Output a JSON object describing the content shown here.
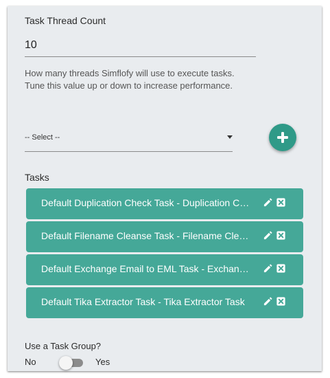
{
  "thread_count": {
    "label": "Task Thread Count",
    "value": "10",
    "help": "How many threads Simflofy will use to execute tasks. Tune this value up or down to increase performance."
  },
  "task_select": {
    "selected": "-- Select --",
    "add_icon": "plus-icon"
  },
  "tasks": {
    "label": "Tasks",
    "items": [
      {
        "label": "Default Duplication Check Task - Duplication Check Task"
      },
      {
        "label": "Default Filename Cleanse Task - Filename Cleanse Task"
      },
      {
        "label": "Default Exchange Email to EML Task - Exchange Email to EML Task"
      },
      {
        "label": "Default Tika Extractor Task - Tika Extractor Task"
      }
    ],
    "edit_icon": "pencil-icon",
    "remove_icon": "close-square-icon"
  },
  "task_group": {
    "label": "Use a Task Group?",
    "off_label": "No",
    "on_label": "Yes",
    "enabled": false
  },
  "colors": {
    "accent": "#2f9a88",
    "task_bg": "#45a898",
    "panel_bg": "#e9ecef"
  }
}
